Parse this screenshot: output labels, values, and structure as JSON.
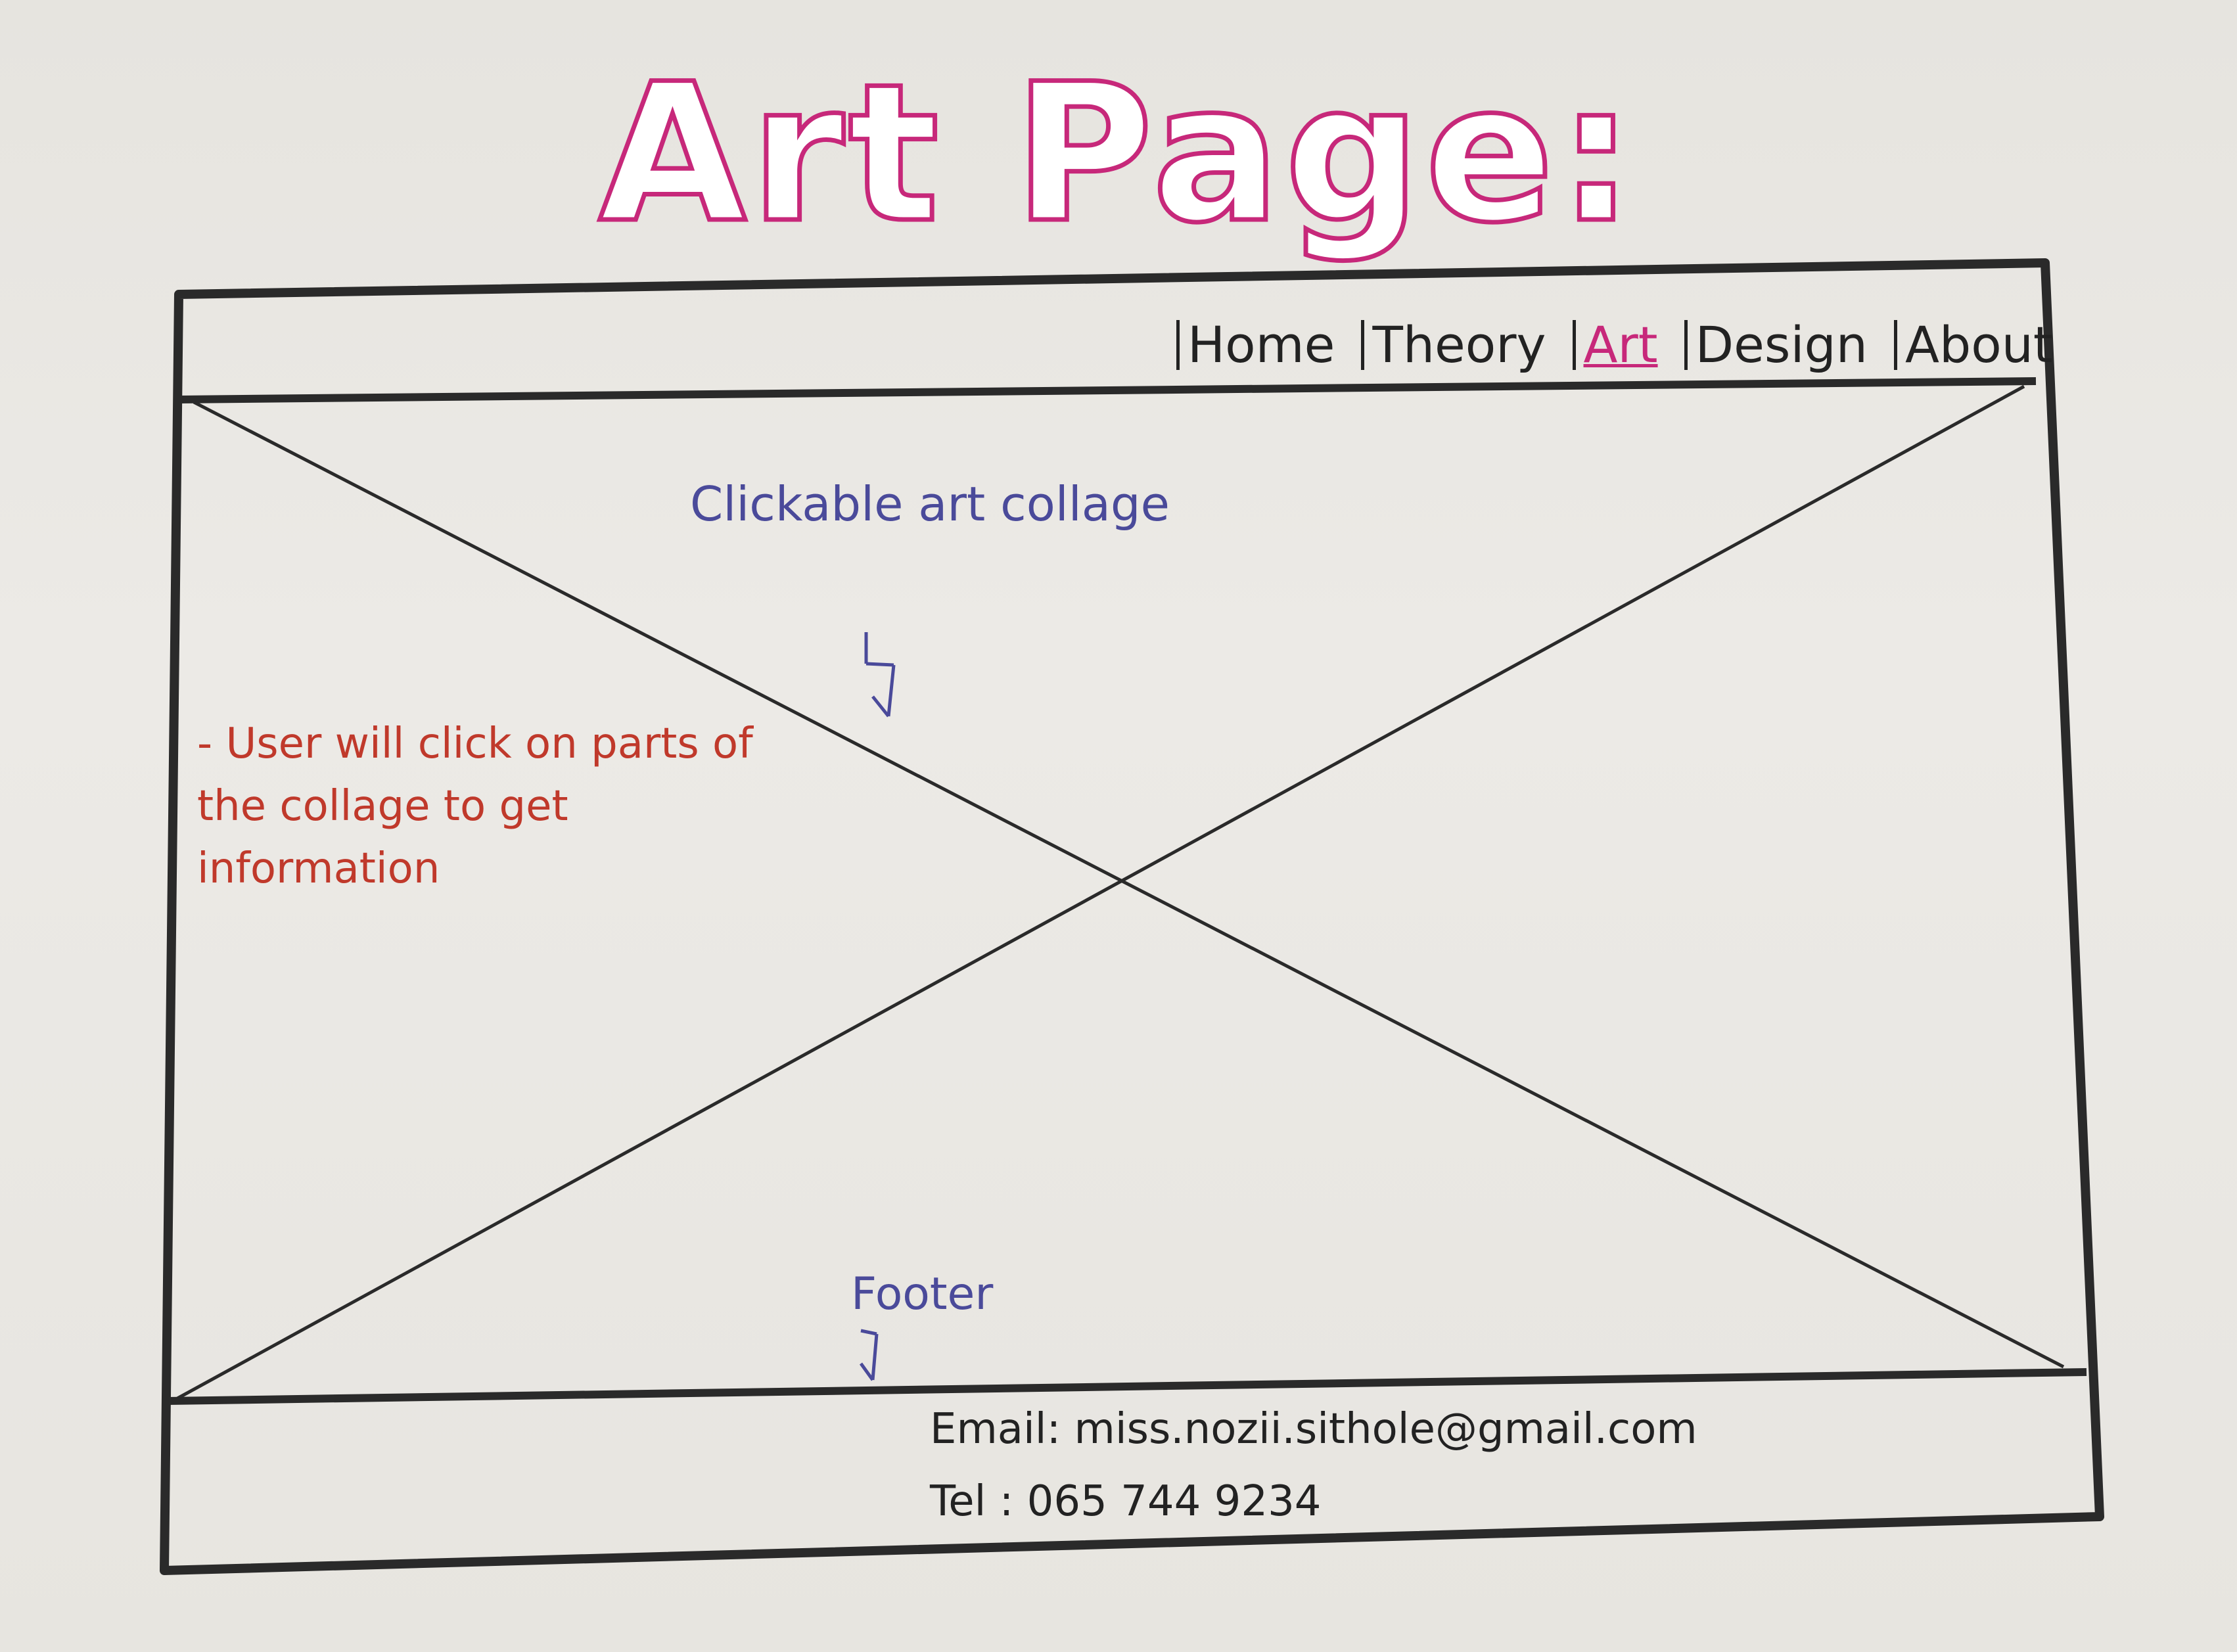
{
  "title": "Art Page:",
  "nav": {
    "items": [
      {
        "label": "Home",
        "active": false
      },
      {
        "label": "Theory",
        "active": false
      },
      {
        "label": "Art",
        "active": true
      },
      {
        "label": "Design",
        "active": false
      },
      {
        "label": "About",
        "active": false
      }
    ]
  },
  "content": {
    "collage_note": "Clickable art collage",
    "user_note": "- User will click on parts of the collage to get information"
  },
  "footer": {
    "label": "Footer",
    "email": "Email: miss.nozii.sithole@gmail.com",
    "tel": "Tel : 065 744 9234"
  },
  "colors": {
    "title": "#c7287a",
    "active_nav": "#c7287a",
    "annotation_blue": "#4a4a9a",
    "annotation_red": "#c0392b",
    "ink": "#222222"
  }
}
